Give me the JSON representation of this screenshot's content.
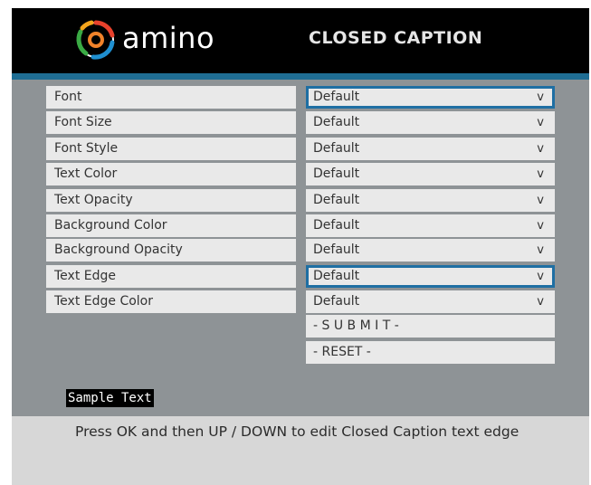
{
  "header": {
    "brand": "amino",
    "title": "CLOSED CAPTION",
    "colors": {
      "background": "#000000",
      "stripe": "#1f6d93"
    },
    "logo_icon": "amino-swirl-icon"
  },
  "settings": [
    {
      "label": "Font",
      "value": "Default",
      "focused": true
    },
    {
      "label": "Font Size",
      "value": "Default",
      "focused": false
    },
    {
      "label": "Font Style",
      "value": "Default",
      "focused": false
    },
    {
      "label": "Text Color",
      "value": "Default",
      "focused": false
    },
    {
      "label": "Text Opacity",
      "value": "Default",
      "focused": false
    },
    {
      "label": "Background Color",
      "value": "Default",
      "focused": false
    },
    {
      "label": "Background Opacity",
      "value": "Default",
      "focused": false
    },
    {
      "label": "Text Edge",
      "value": "Default",
      "focused": true
    },
    {
      "label": "Text Edge Color",
      "value": "Default",
      "focused": false
    }
  ],
  "dropdown_glyph": "v",
  "actions": {
    "submit": "- S U B M I T -",
    "reset": "- RESET -"
  },
  "sample_text": "Sample Text",
  "instructions": "Press OK and then UP / DOWN to edit Closed Caption text edge",
  "colors": {
    "focus_border": "#1f6fa3",
    "panel_bg": "#8e9396",
    "field_bg": "#e9e9e9"
  }
}
